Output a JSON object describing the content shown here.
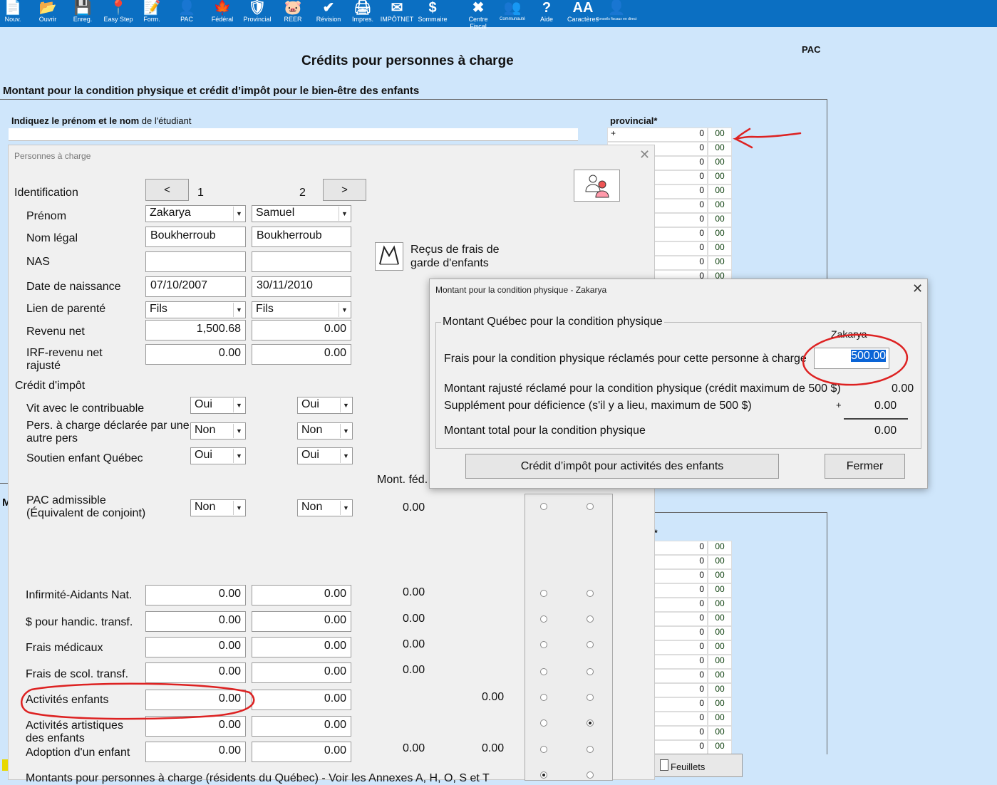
{
  "toolbar": [
    {
      "label": "Nouv.",
      "icon": "new-document-icon"
    },
    {
      "label": "Ouvrir",
      "icon": "folder-open-icon"
    },
    {
      "label": "Enreg.",
      "icon": "save-icon"
    },
    {
      "label": "Easy Step",
      "icon": "map-pin-icon"
    },
    {
      "label": "Form.",
      "icon": "form-edit-icon"
    },
    {
      "label": "PAC",
      "icon": "people-icon"
    },
    {
      "label": "Fédéral",
      "icon": "maple-leaf-icon"
    },
    {
      "label": "Provincial",
      "icon": "shield-icon"
    },
    {
      "label": "REER",
      "icon": "piggy-bank-icon"
    },
    {
      "label": "Révision",
      "icon": "checkmark-icon"
    },
    {
      "label": "Impres.",
      "icon": "printer-icon"
    },
    {
      "label": "IMPÔTNET",
      "icon": "envelope-icon"
    },
    {
      "label": "Sommaire",
      "icon": "dollar-icon"
    },
    {
      "label": "Centre\nFiscal",
      "icon": "tools-icon"
    },
    {
      "label": "Communauté",
      "icon": "community-icon"
    },
    {
      "label": "Aide",
      "icon": "help-icon"
    },
    {
      "label": "Caractères",
      "icon": "font-size-icon"
    },
    {
      "label": "Conseils fiscaux en direct",
      "icon": "advisor-icon"
    }
  ],
  "page": {
    "title": "Crédits pour personnes à charge",
    "code": "PAC",
    "section": "Montant pour la condition physique et crédit d’impôt pour le bien-être des enfants",
    "student_label_bold": "Indiquez le prénom et le nom",
    "student_label_rest": " de l'étudiant",
    "prov_label": "provincial*",
    "grid_plus": "+",
    "grid_zero": "0",
    "grid_cents": "00",
    "prov_label2": "*",
    "feuillets": "Feuillets",
    "left_stub": "M"
  },
  "pers": {
    "title": "Personnes à charge",
    "prev": "<",
    "next": ">",
    "col1": "1",
    "col2": "2",
    "labels": {
      "identification": "Identification",
      "prenom": "Prénom",
      "nom": "Nom légal",
      "nas": "NAS",
      "naissance": "Date de naissance",
      "lien": "Lien de parenté",
      "revenu": "Revenu net",
      "irf1": "IRF-revenu net",
      "irf2": "rajusté",
      "credit": "Crédit d'impôt",
      "vit": "Vit avec le contribuable",
      "pers1": "Pers. à charge déclarée par une",
      "pers2": "autre pers",
      "soutien": "Soutien enfant Québec",
      "mont_fed": "Mont. féd.",
      "pac1": "PAC admissible",
      "pac2": "(Équivalent de conjoint)",
      "infirm": "Infirmité-Aidants Nat.",
      "handic": "$ pour handic. transf.",
      "medic": "Frais médicaux",
      "scol": "Frais de scol. transf.",
      "activ": "Activités enfants",
      "artist1": "Activités artistiques",
      "artist2": "des enfants",
      "adopt": "Adoption d'un enfant",
      "bottom": "Montants pour personnes à charge (résidents du Québec) - Voir les Annexes A, H, O, S et T"
    },
    "receipts1": "Reçus de frais de",
    "receipts2": "garde d'enfants",
    "p1": {
      "prenom": "Zakarya",
      "nom": "Boukherroub",
      "nas": "",
      "naissance": "07/10/2007",
      "lien": "Fils",
      "revenu": "1,500.68",
      "irf": "0.00",
      "vit": "Oui",
      "pers": "Non",
      "soutien": "Oui",
      "pac": "Non",
      "infirm": "0.00",
      "handic": "0.00",
      "medic": "0.00",
      "scol": "0.00",
      "activ": "0.00",
      "artist": "0.00",
      "adopt": "0.00"
    },
    "p2": {
      "prenom": "Samuel",
      "nom": "Boukherroub",
      "nas": "",
      "naissance": "30/11/2010",
      "lien": "Fils",
      "revenu": "0.00",
      "irf": "0.00",
      "vit": "Oui",
      "pers": "Non",
      "soutien": "Oui",
      "pac": "Non",
      "infirm": "0.00",
      "handic": "0.00",
      "medic": "0.00",
      "scol": "0.00",
      "activ": "0.00",
      "artist": "0.00",
      "adopt": "0.00"
    },
    "fed": {
      "pac": "0.00",
      "infirm": "0.00",
      "handic": "0.00",
      "medic": "0.00",
      "scol": "0.00",
      "adopt": "0.00"
    },
    "prov": {
      "activ": "0.00",
      "adopt": "0.00"
    }
  },
  "cond": {
    "title": "Montant pour la condition physique - Zakarya",
    "group": "Montant Québec pour la condition physique",
    "name": "Zakarya",
    "frais_label": "Frais pour la condition physique réclamés pour cette personne à charge",
    "frais_value": "500.00",
    "rajuste_label": "Montant rajusté réclamé pour la condition physique (crédit maximum de 500 $)",
    "rajuste_value": "0.00",
    "supp_label": "Supplément pour déficience (s'il y a lieu, maximum de 500 $)",
    "supp_plus": "+",
    "supp_value": "0.00",
    "total_label": "Montant total pour la condition physique",
    "total_value": "0.00",
    "btn_credit": "Crédit d’impôt pour activités des enfants",
    "btn_close": "Fermer"
  }
}
